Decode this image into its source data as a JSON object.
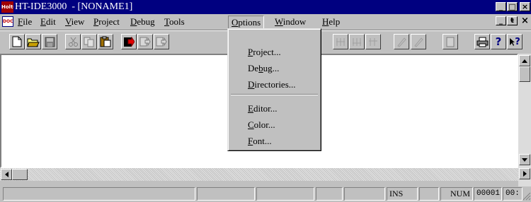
{
  "window": {
    "title": "HT-IDE3000  - [NONAME1]",
    "app_icon_text": "Holtek",
    "min_glyph": "_",
    "max_glyph": "□",
    "close_glyph": "×",
    "restore_glyph": "ŧ"
  },
  "menubar": {
    "doc_icon_text": "DOC",
    "items": [
      {
        "pre": "",
        "accel": "F",
        "post": "ile"
      },
      {
        "pre": "",
        "accel": "E",
        "post": "dit"
      },
      {
        "pre": "",
        "accel": "V",
        "post": "iew"
      },
      {
        "pre": "",
        "accel": "P",
        "post": "roject"
      },
      {
        "pre": "",
        "accel": "D",
        "post": "ebug"
      },
      {
        "pre": "",
        "accel": "T",
        "post": "ools"
      },
      {
        "pre": "",
        "accel": "O",
        "post": "ptions"
      },
      {
        "pre": "",
        "accel": "W",
        "post": "indow"
      },
      {
        "pre": "",
        "accel": "H",
        "post": "elp"
      }
    ]
  },
  "options_menu": {
    "items": [
      {
        "pre": "",
        "accel": "P",
        "post": "roject..."
      },
      {
        "pre": "De",
        "accel": "b",
        "post": "ug..."
      },
      {
        "pre": "",
        "accel": "D",
        "post": "irectories..."
      },
      {
        "pre": "",
        "accel": "E",
        "post": "ditor..."
      },
      {
        "pre": "",
        "accel": "C",
        "post": "olor..."
      },
      {
        "pre": "",
        "accel": "F",
        "post": "ont..."
      }
    ]
  },
  "toolbar": {
    "help_glyph": "?",
    "context_help_glyph": "?"
  },
  "statusbar": {
    "ins": "INS",
    "num": "NUM",
    "line": "00001",
    "col": "00:"
  },
  "colors": {
    "title_bg": "#000080",
    "face": "#c0c0c0",
    "editor_bg": "#ffffff"
  }
}
